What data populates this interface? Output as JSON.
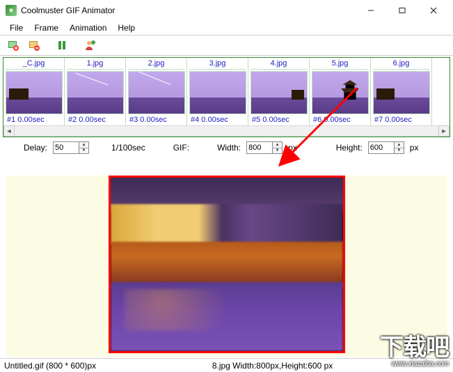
{
  "window": {
    "title": "Coolmuster GIF Animator",
    "controls": {
      "min": "minimize",
      "max": "maximize",
      "close": "close"
    }
  },
  "menu": {
    "file": "File",
    "frame": "Frame",
    "animation": "Animation",
    "help": "Help"
  },
  "toolbar": {
    "add": "add-frame",
    "delete": "delete-frame",
    "pause": "pause",
    "about": "about"
  },
  "frames": [
    {
      "name": "_C.jpg",
      "label": "#1  0.00sec"
    },
    {
      "name": "1.jpg",
      "label": "#2  0.00sec"
    },
    {
      "name": "2.jpg",
      "label": "#3  0.00sec"
    },
    {
      "name": "3.jpg",
      "label": "#4  0.00sec"
    },
    {
      "name": "4.jpg",
      "label": "#5  0.00sec"
    },
    {
      "name": "5.jpg",
      "label": "#6  0.00sec"
    },
    {
      "name": "6.jpg",
      "label": "#7  0.00sec"
    }
  ],
  "controls": {
    "delay_label": "Delay:",
    "delay_value": "50",
    "delay_unit": "1/100sec",
    "gif_label": "GIF:",
    "width_label": "Width:",
    "width_value": "800",
    "height_label": "Height:",
    "height_value": "600",
    "px": "px"
  },
  "status": {
    "left": "Untitled.gif (800 * 600)px",
    "center": "8.jpg Width:800px,Height:600 px"
  },
  "watermark": {
    "big": "下载吧",
    "url": "www.xiazaiba.com"
  }
}
